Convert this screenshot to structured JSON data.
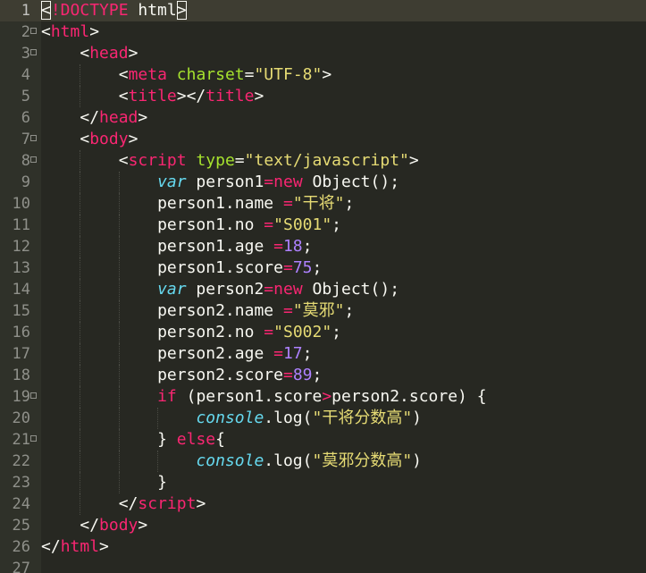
{
  "editor": {
    "active_line": 1,
    "colors": {
      "background": "#272822",
      "gutter": "#2f3129",
      "plain": "#f8f8f2",
      "tag": "#f92672",
      "attribute": "#a6e22e",
      "string": "#e6db74",
      "keyword": "#f92672",
      "storage": "#66d9ef",
      "number": "#ae81ff",
      "line_number": "#8f908a"
    },
    "lines": [
      {
        "n": "1",
        "fold": false,
        "indent": 0,
        "tokens": [
          [
            "pl",
            "<"
          ],
          [
            "tag",
            "!DOCTYPE"
          ],
          [
            "pl",
            " html"
          ],
          [
            "pl",
            ">"
          ]
        ]
      },
      {
        "n": "2",
        "fold": true,
        "indent": 0,
        "tokens": [
          [
            "pl",
            "<"
          ],
          [
            "tag",
            "html"
          ],
          [
            "pl",
            ">"
          ]
        ]
      },
      {
        "n": "3",
        "fold": true,
        "indent": 1,
        "tokens": [
          [
            "pl",
            "<"
          ],
          [
            "tag",
            "head"
          ],
          [
            "pl",
            ">"
          ]
        ]
      },
      {
        "n": "4",
        "fold": false,
        "indent": 2,
        "tokens": [
          [
            "pl",
            "<"
          ],
          [
            "tag",
            "meta"
          ],
          [
            "pl",
            " "
          ],
          [
            "attr",
            "charset"
          ],
          [
            "pl",
            "="
          ],
          [
            "str",
            "\"UTF-8\""
          ],
          [
            "pl",
            ">"
          ]
        ]
      },
      {
        "n": "5",
        "fold": false,
        "indent": 2,
        "tokens": [
          [
            "pl",
            "<"
          ],
          [
            "tag",
            "title"
          ],
          [
            "pl",
            "></"
          ],
          [
            "tag",
            "title"
          ],
          [
            "pl",
            ">"
          ]
        ]
      },
      {
        "n": "6",
        "fold": false,
        "indent": 1,
        "tokens": [
          [
            "pl",
            "</"
          ],
          [
            "tag",
            "head"
          ],
          [
            "pl",
            ">"
          ]
        ]
      },
      {
        "n": "7",
        "fold": true,
        "indent": 1,
        "tokens": [
          [
            "pl",
            "<"
          ],
          [
            "tag",
            "body"
          ],
          [
            "pl",
            ">"
          ]
        ]
      },
      {
        "n": "8",
        "fold": true,
        "indent": 2,
        "tokens": [
          [
            "pl",
            "<"
          ],
          [
            "tag",
            "script"
          ],
          [
            "pl",
            " "
          ],
          [
            "attr",
            "type"
          ],
          [
            "pl",
            "="
          ],
          [
            "str",
            "\"text/javascript\""
          ],
          [
            "pl",
            ">"
          ]
        ]
      },
      {
        "n": "9",
        "fold": false,
        "indent": 3,
        "tokens": [
          [
            "st",
            "var"
          ],
          [
            "pl",
            " person1"
          ],
          [
            "kw",
            "="
          ],
          [
            "kw",
            "new"
          ],
          [
            "pl",
            " Object();"
          ]
        ]
      },
      {
        "n": "10",
        "fold": false,
        "indent": 3,
        "tokens": [
          [
            "pl",
            "person1.name "
          ],
          [
            "kw",
            "="
          ],
          [
            "str",
            "\"干将\""
          ],
          [
            "pl",
            ";"
          ]
        ]
      },
      {
        "n": "11",
        "fold": false,
        "indent": 3,
        "tokens": [
          [
            "pl",
            "person1.no "
          ],
          [
            "kw",
            "="
          ],
          [
            "str",
            "\"S001\""
          ],
          [
            "pl",
            ";"
          ]
        ]
      },
      {
        "n": "12",
        "fold": false,
        "indent": 3,
        "tokens": [
          [
            "pl",
            "person1.age "
          ],
          [
            "kw",
            "="
          ],
          [
            "num",
            "18"
          ],
          [
            "pl",
            ";"
          ]
        ]
      },
      {
        "n": "13",
        "fold": false,
        "indent": 3,
        "tokens": [
          [
            "pl",
            "person1.score"
          ],
          [
            "kw",
            "="
          ],
          [
            "num",
            "75"
          ],
          [
            "pl",
            ";"
          ]
        ]
      },
      {
        "n": "14",
        "fold": false,
        "indent": 3,
        "tokens": [
          [
            "st",
            "var"
          ],
          [
            "pl",
            " person2"
          ],
          [
            "kw",
            "="
          ],
          [
            "kw",
            "new"
          ],
          [
            "pl",
            " Object();"
          ]
        ]
      },
      {
        "n": "15",
        "fold": false,
        "indent": 3,
        "tokens": [
          [
            "pl",
            "person2.name "
          ],
          [
            "kw",
            "="
          ],
          [
            "str",
            "\"莫邪\""
          ],
          [
            "pl",
            ";"
          ]
        ]
      },
      {
        "n": "16",
        "fold": false,
        "indent": 3,
        "tokens": [
          [
            "pl",
            "person2.no "
          ],
          [
            "kw",
            "="
          ],
          [
            "str",
            "\"S002\""
          ],
          [
            "pl",
            ";"
          ]
        ]
      },
      {
        "n": "17",
        "fold": false,
        "indent": 3,
        "tokens": [
          [
            "pl",
            "person2.age "
          ],
          [
            "kw",
            "="
          ],
          [
            "num",
            "17"
          ],
          [
            "pl",
            ";"
          ]
        ]
      },
      {
        "n": "18",
        "fold": false,
        "indent": 3,
        "tokens": [
          [
            "pl",
            "person2.score"
          ],
          [
            "kw",
            "="
          ],
          [
            "num",
            "89"
          ],
          [
            "pl",
            ";"
          ]
        ]
      },
      {
        "n": "19",
        "fold": true,
        "indent": 3,
        "tokens": [
          [
            "kw",
            "if"
          ],
          [
            "pl",
            " (person1.score"
          ],
          [
            "kw",
            ">"
          ],
          [
            "pl",
            "person2.score) {"
          ]
        ]
      },
      {
        "n": "20",
        "fold": false,
        "indent": 4,
        "tokens": [
          [
            "st",
            "console"
          ],
          [
            "pl",
            ".log("
          ],
          [
            "str",
            "\"干将分数高\""
          ],
          [
            "pl",
            ")"
          ]
        ]
      },
      {
        "n": "21",
        "fold": true,
        "indent": 3,
        "tokens": [
          [
            "pl",
            "} "
          ],
          [
            "kw",
            "else"
          ],
          [
            "pl",
            "{"
          ]
        ]
      },
      {
        "n": "22",
        "fold": false,
        "indent": 4,
        "tokens": [
          [
            "st",
            "console"
          ],
          [
            "pl",
            ".log("
          ],
          [
            "str",
            "\"莫邪分数高\""
          ],
          [
            "pl",
            ")"
          ]
        ]
      },
      {
        "n": "23",
        "fold": false,
        "indent": 3,
        "tokens": [
          [
            "pl",
            "}"
          ]
        ]
      },
      {
        "n": "24",
        "fold": false,
        "indent": 2,
        "tokens": [
          [
            "pl",
            "</"
          ],
          [
            "tag",
            "script"
          ],
          [
            "pl",
            ">"
          ]
        ]
      },
      {
        "n": "25",
        "fold": false,
        "indent": 1,
        "tokens": [
          [
            "pl",
            "</"
          ],
          [
            "tag",
            "body"
          ],
          [
            "pl",
            ">"
          ]
        ]
      },
      {
        "n": "26",
        "fold": false,
        "indent": 0,
        "tokens": [
          [
            "pl",
            "</"
          ],
          [
            "tag",
            "html"
          ],
          [
            "pl",
            ">"
          ]
        ]
      },
      {
        "n": "27",
        "fold": false,
        "indent": 0,
        "tokens": []
      }
    ]
  }
}
